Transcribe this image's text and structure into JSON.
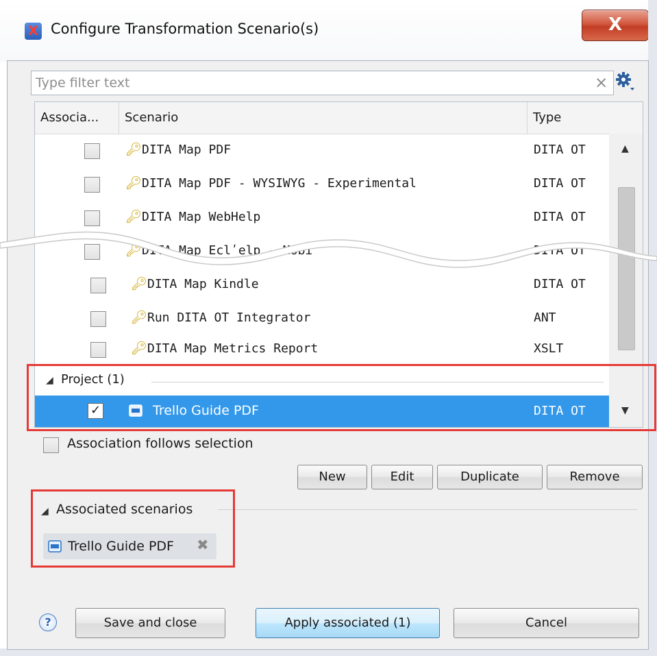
{
  "window": {
    "title": "Configure Transformation Scenario(s)",
    "close_label": "X",
    "app_icon": "oxygen-app-icon"
  },
  "filter": {
    "placeholder": "Type filter text",
    "value": "",
    "clear_icon": "×"
  },
  "table": {
    "columns": [
      "Associa...",
      "Scenario",
      "Type"
    ],
    "rows": [
      {
        "checked": false,
        "name": "DITA Map PDF",
        "type": "DITA OT",
        "icon": "key-icon"
      },
      {
        "checked": false,
        "name": "DITA Map PDF - WYSIWYG - Experimental",
        "type": "DITA OT",
        "icon": "key-icon"
      },
      {
        "checked": false,
        "name": "DITA Map WebHelp",
        "type": "DITA OT",
        "icon": "key-icon"
      },
      {
        "checked": false,
        "name": "DITA Map Eclʹelp - Mobi",
        "type": "DITA OT",
        "icon": "key-icon"
      },
      {
        "checked": false,
        "name": "DITA Map Kindle",
        "type": "DITA OT",
        "icon": "key-icon"
      },
      {
        "checked": false,
        "name": "Run DITA OT Integrator",
        "type": "ANT",
        "icon": "key-icon"
      },
      {
        "checked": false,
        "name": "DITA Map Metrics Report",
        "type": "XSLT",
        "icon": "key-icon"
      }
    ],
    "group": {
      "label": "Project (1)"
    },
    "selected_row": {
      "checked": true,
      "name": "Trello Guide PDF",
      "type": "DITA OT"
    }
  },
  "association": {
    "checkbox_label": "Association follows selection",
    "checked": false
  },
  "buttons": {
    "new": "New",
    "edit": "Edit",
    "duplicate": "Duplicate",
    "remove": "Remove"
  },
  "associated": {
    "title": "Associated scenarios",
    "chips": [
      "Trello Guide PDF"
    ]
  },
  "footer": {
    "save": "Save and close",
    "apply": "Apply associated (1)",
    "cancel": "Cancel",
    "help": "?"
  },
  "colors": {
    "selection": "#3398ea",
    "highlight": "#e53935",
    "key": "#c9a000"
  }
}
